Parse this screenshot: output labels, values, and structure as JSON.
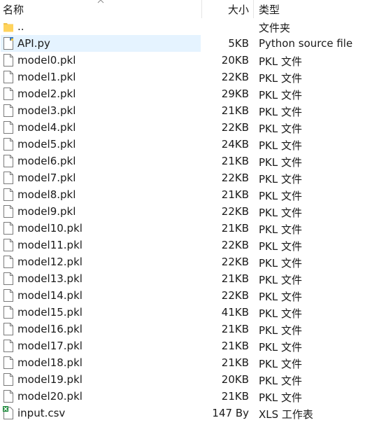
{
  "header": {
    "name": "名称",
    "size": "大小",
    "type": "类型"
  },
  "files": [
    {
      "name": "..",
      "size": "",
      "type": "文件夹",
      "icon": "folder-icon"
    },
    {
      "name": "API.py",
      "size": "5KB",
      "type": "Python source file",
      "icon": "python-file-icon",
      "selected": true
    },
    {
      "name": "model0.pkl",
      "size": "20KB",
      "type": "PKL 文件",
      "icon": "file-icon"
    },
    {
      "name": "model1.pkl",
      "size": "22KB",
      "type": "PKL 文件",
      "icon": "file-icon"
    },
    {
      "name": "model2.pkl",
      "size": "29KB",
      "type": "PKL 文件",
      "icon": "file-icon"
    },
    {
      "name": "model3.pkl",
      "size": "21KB",
      "type": "PKL 文件",
      "icon": "file-icon"
    },
    {
      "name": "model4.pkl",
      "size": "22KB",
      "type": "PKL 文件",
      "icon": "file-icon"
    },
    {
      "name": "model5.pkl",
      "size": "24KB",
      "type": "PKL 文件",
      "icon": "file-icon"
    },
    {
      "name": "model6.pkl",
      "size": "21KB",
      "type": "PKL 文件",
      "icon": "file-icon"
    },
    {
      "name": "model7.pkl",
      "size": "22KB",
      "type": "PKL 文件",
      "icon": "file-icon"
    },
    {
      "name": "model8.pkl",
      "size": "21KB",
      "type": "PKL 文件",
      "icon": "file-icon"
    },
    {
      "name": "model9.pkl",
      "size": "22KB",
      "type": "PKL 文件",
      "icon": "file-icon"
    },
    {
      "name": "model10.pkl",
      "size": "21KB",
      "type": "PKL 文件",
      "icon": "file-icon"
    },
    {
      "name": "model11.pkl",
      "size": "22KB",
      "type": "PKL 文件",
      "icon": "file-icon"
    },
    {
      "name": "model12.pkl",
      "size": "22KB",
      "type": "PKL 文件",
      "icon": "file-icon"
    },
    {
      "name": "model13.pkl",
      "size": "21KB",
      "type": "PKL 文件",
      "icon": "file-icon"
    },
    {
      "name": "model14.pkl",
      "size": "22KB",
      "type": "PKL 文件",
      "icon": "file-icon"
    },
    {
      "name": "model15.pkl",
      "size": "41KB",
      "type": "PKL 文件",
      "icon": "file-icon"
    },
    {
      "name": "model16.pkl",
      "size": "21KB",
      "type": "PKL 文件",
      "icon": "file-icon"
    },
    {
      "name": "model17.pkl",
      "size": "21KB",
      "type": "PKL 文件",
      "icon": "file-icon"
    },
    {
      "name": "model18.pkl",
      "size": "21KB",
      "type": "PKL 文件",
      "icon": "file-icon"
    },
    {
      "name": "model19.pkl",
      "size": "20KB",
      "type": "PKL 文件",
      "icon": "file-icon"
    },
    {
      "name": "model20.pkl",
      "size": "21KB",
      "type": "PKL 文件",
      "icon": "file-icon"
    },
    {
      "name": "input.csv",
      "size": "147 By",
      "type": "XLS 工作表",
      "icon": "csv-file-icon"
    }
  ]
}
